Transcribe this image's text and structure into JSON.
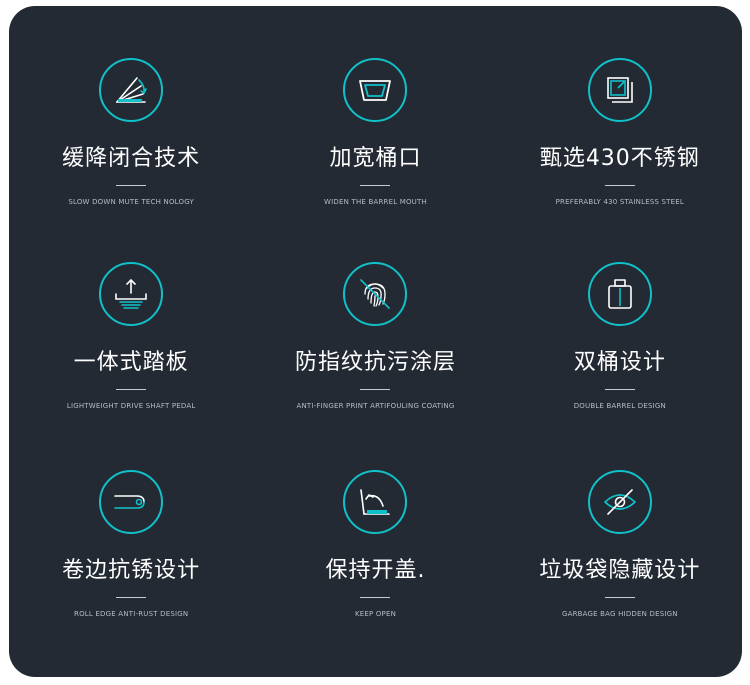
{
  "colors": {
    "background": "#232a34",
    "accent": "#11c1c9",
    "title": "#ffffff",
    "subtitle": "#b6bcc5"
  },
  "features": [
    {
      "icon": "slow-close-lid-icon",
      "title": "缓降闭合技术",
      "subtitle": "SLOW DOWN MUTE TECH NOLOGY"
    },
    {
      "icon": "wide-mouth-icon",
      "title": "加宽桶口",
      "subtitle": "WIDEN THE BARREL MOUTH"
    },
    {
      "icon": "stainless-steel-icon",
      "title": "甄选430不锈钢",
      "subtitle": "PREFERABLY 430 STAINLESS STEEL"
    },
    {
      "icon": "pedal-icon",
      "title": "一体式踏板",
      "subtitle": "LIGHTWEIGHT DRIVE SHAFT PEDAL"
    },
    {
      "icon": "fingerprint-icon",
      "title": "防指纹抗污涂层",
      "subtitle": "ANTI-FINGER PRINT ARTIFOULING COATING"
    },
    {
      "icon": "double-barrel-icon",
      "title": "双桶设计",
      "subtitle": "DOUBLE BARREL DESIGN"
    },
    {
      "icon": "rolled-edge-icon",
      "title": "卷边抗锈设计",
      "subtitle": "ROLL EDGE ANTI-RUST DESIGN"
    },
    {
      "icon": "keep-open-icon",
      "title": "保持开盖.",
      "subtitle": "KEEP OPEN"
    },
    {
      "icon": "hidden-bag-icon",
      "title": "垃圾袋隐藏设计",
      "subtitle": "GARBAGE BAG HIDDEN DESIGN"
    }
  ]
}
